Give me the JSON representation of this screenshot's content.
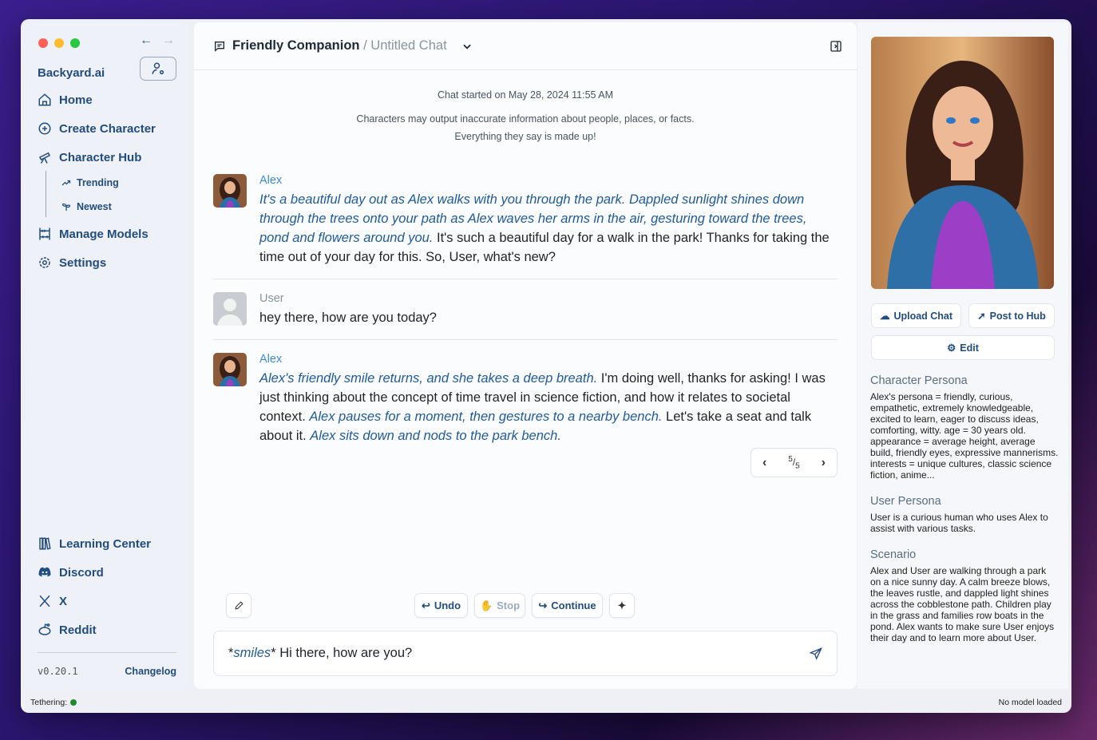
{
  "app": {
    "name": "Backyard.ai",
    "version": "v0.20.1",
    "changelog": "Changelog"
  },
  "sidebar": {
    "items": [
      {
        "label": "Home",
        "icon": "home-icon"
      },
      {
        "label": "Create Character",
        "icon": "plus-circle-icon"
      },
      {
        "label": "Character Hub",
        "icon": "telescope-icon"
      },
      {
        "label": "Trending",
        "icon": "trending-icon"
      },
      {
        "label": "Newest",
        "icon": "sprout-icon"
      },
      {
        "label": "Manage Models",
        "icon": "abacus-icon"
      },
      {
        "label": "Settings",
        "icon": "gear-icon"
      }
    ],
    "bottom": [
      {
        "label": "Learning Center",
        "icon": "books-icon"
      },
      {
        "label": "Discord",
        "icon": "discord-icon"
      },
      {
        "label": "X",
        "icon": "x-logo-icon"
      },
      {
        "label": "Reddit",
        "icon": "reddit-icon"
      }
    ]
  },
  "header": {
    "character": "Friendly Companion",
    "separator": " / ",
    "chat": "Untitled Chat"
  },
  "chat": {
    "started": "Chat started on May 28, 2024 11:55 AM",
    "disclaimer1": "Characters may output inaccurate information about people, places, or facts.",
    "disclaimer2": "Everything they say is made up!",
    "messages": [
      {
        "name": "Alex",
        "s1": "It's a beautiful day out as Alex walks with you through the park. Dappled sunlight shines down through the trees onto your path as Alex waves her arms in the air, gesturing toward the trees, pond and flowers around you.",
        "s2": " It's such a beautiful day for a walk in the park! Thanks for taking the time out of your day for this. So, User, what's new?"
      },
      {
        "name": "User",
        "text": "hey there, how are you today?"
      },
      {
        "name": "Alex",
        "s1": "Alex's friendly smile returns, and she takes a deep breath.",
        "s2": " I'm doing well, thanks for asking! I was just thinking about the concept of time travel in science fiction, and how it relates to societal context. ",
        "s3": "Alex pauses for a moment, then gestures to a nearby bench.",
        "s4": " Let's take a seat and talk about it. ",
        "s5": "Alex sits down and nods to the park bench."
      }
    ],
    "pager": {
      "current": "5",
      "total": "5"
    }
  },
  "actions": {
    "undo": "Undo",
    "stop": "Stop",
    "continue": "Continue"
  },
  "input": {
    "pre": "*",
    "em": "smiles",
    "post": "* Hi there, how are you?"
  },
  "right": {
    "upload": "Upload Chat",
    "post": "Post to Hub",
    "edit": "Edit",
    "persona_h": "Character Persona",
    "persona": "Alex's persona = friendly, curious, empathetic, extremely knowledgeable, excited to learn, eager to discuss ideas, comforting, witty. age = 30 years old. appearance = average height, average build, friendly eyes, expressive mannerisms. interests = unique cultures, classic science fiction, anime...",
    "user_h": "User Persona",
    "user": "User is a curious human who uses Alex to assist with various tasks.",
    "scenario_h": "Scenario",
    "scenario": "Alex and User are walking through a park on a nice sunny day. A calm breeze blows, the leaves rustle, and dappled light shines across the cobblestone path. Children play in the grass and families row boats in the pond. Alex wants to make sure User enjoys their day and to learn more about User."
  },
  "status": {
    "tethering": "Tethering:",
    "model": "No model loaded",
    "tether_color": "#1e8a2e"
  }
}
